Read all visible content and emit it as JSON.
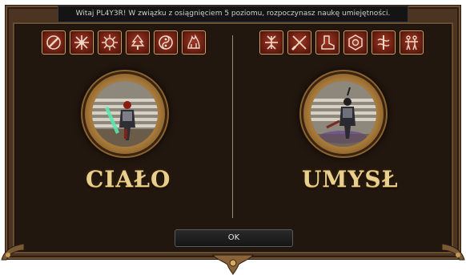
{
  "notification": {
    "text": "Witaj PL4Y3R! W związku z osiągnięciem 5 poziomu, rozpoczynasz naukę umiejętności."
  },
  "paths": [
    {
      "label": "CIAŁO",
      "skills": [
        "whirl-slash-icon",
        "star-burst-icon",
        "spiked-sun-icon",
        "tree-icon",
        "yin-yang-icon",
        "flame-beast-icon"
      ]
    },
    {
      "label": "UMYSŁ",
      "skills": [
        "cross-blades-icon",
        "crossed-swords-icon",
        "boot-icon",
        "hex-ring-icon",
        "sword-swirl-icon",
        "warriors-icon"
      ]
    }
  ],
  "actions": {
    "ok_label": "OK"
  },
  "colors": {
    "frame": "#4b3422",
    "panel": "#22170f",
    "skill_bg": "#6d1f12",
    "label_gold": "#e9cf8e"
  }
}
